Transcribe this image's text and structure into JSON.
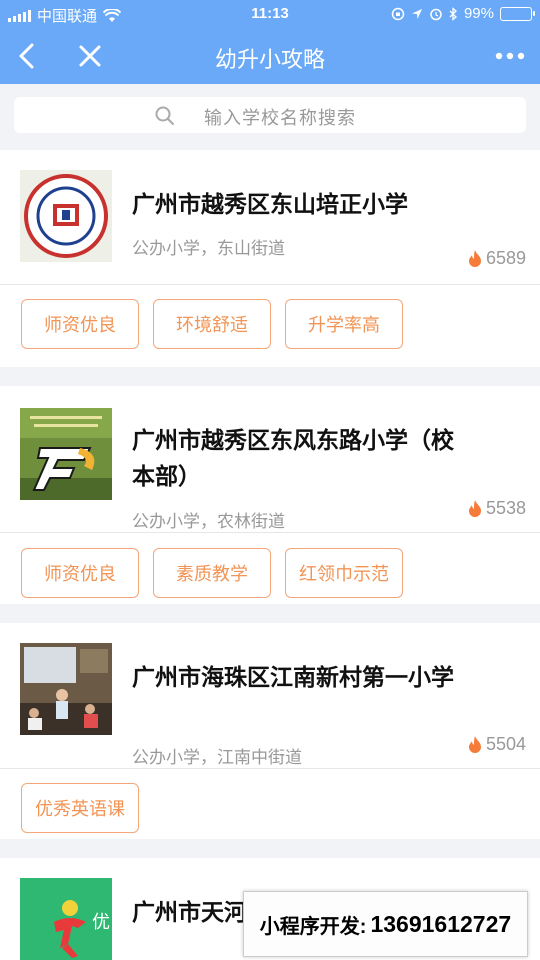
{
  "status_bar": {
    "carrier": "中国联通",
    "time": "11:13",
    "battery": "99%"
  },
  "nav": {
    "title": "幼升小攻略"
  },
  "search": {
    "placeholder": "输入学校名称搜索"
  },
  "schools": [
    {
      "name": "广州市越秀区东山培正小学",
      "sub": "公办小学，东山街道",
      "hot": "6589",
      "tags": [
        "师资优良",
        "环境舒适",
        "升学率高"
      ]
    },
    {
      "name": "广州市越秀区东风东路小学（校本部）",
      "sub": "公办小学，农林街道",
      "hot": "5538",
      "tags": [
        "师资优良",
        "素质教学",
        "红领巾示范"
      ]
    },
    {
      "name": "广州市海珠区江南新村第一小学",
      "sub": "公办小学，江南中街道",
      "hot": "5504",
      "tags": [
        "优秀英语课"
      ]
    },
    {
      "name": "广州市天河（北校区）"
    }
  ],
  "watermark": {
    "label": "小程序开发:",
    "phone": "13691612727"
  },
  "colors": {
    "brand_blue": "#6aa9f7",
    "tag_orange": "#f29455",
    "flame": "#f47b3a"
  }
}
